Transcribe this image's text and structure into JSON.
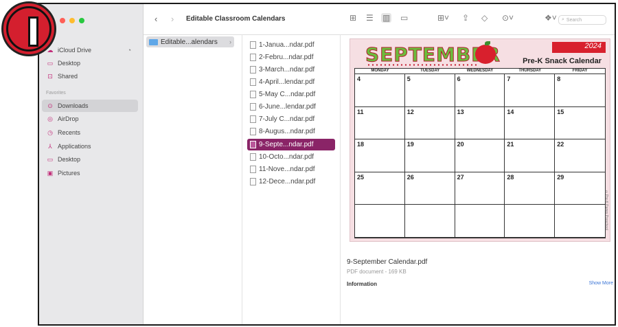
{
  "badge": {
    "glyph": "I"
  },
  "sidebar": {
    "lights": [
      "#ff5f57",
      "#febc2e",
      "#28c840"
    ],
    "icloud_drive": "iCloud Drive",
    "items_top": [
      {
        "label": "Desktop",
        "icon": "desktop-icon"
      },
      {
        "label": "Shared",
        "icon": "shared-folder-icon"
      }
    ],
    "favorites_header": "Favorites",
    "favorites": [
      {
        "label": "Downloads",
        "icon": "download-icon",
        "active": true
      },
      {
        "label": "AirDrop",
        "icon": "airdrop-icon"
      },
      {
        "label": "Recents",
        "icon": "clock-icon"
      },
      {
        "label": "Applications",
        "icon": "applications-icon"
      },
      {
        "label": "Desktop",
        "icon": "desktop-icon"
      },
      {
        "label": "Pictures",
        "icon": "pictures-icon"
      }
    ]
  },
  "toolbar": {
    "title": "Editable Classroom Calendars",
    "search_placeholder": "Search"
  },
  "columns": {
    "folder": "Editable...alendars",
    "files": [
      "1-Janua...ndar.pdf",
      "2-Febru...ndar.pdf",
      "3-March...ndar.pdf",
      "4-April...lendar.pdf",
      "5-May C...ndar.pdf",
      "6-June...lendar.pdf",
      "7-July C...ndar.pdf",
      "8-Augus...ndar.pdf",
      "9-Septe...ndar.pdf",
      "10-Octo...ndar.pdf",
      "11-Nove...ndar.pdf",
      "12-Dece...ndar.pdf"
    ],
    "selected_index": 8
  },
  "preview": {
    "calendar": {
      "month": "SEPTEMBER",
      "year": "2024",
      "subtitle": "Pre-K Snack Calendar",
      "days": [
        "MONDAY",
        "TUESDAY",
        "WEDNESDAY",
        "THURSDAY",
        "FRIDAY"
      ],
      "weeks": [
        [
          "4",
          "5",
          "6",
          "7",
          "8"
        ],
        [
          "11",
          "12",
          "13",
          "14",
          "15"
        ],
        [
          "18",
          "19",
          "20",
          "21",
          "22"
        ],
        [
          "25",
          "26",
          "27",
          "28",
          "29"
        ],
        [
          "",
          "",
          "",
          "",
          ""
        ]
      ],
      "credit": "©Pre-K Pages Preschool"
    },
    "filename": "9-September Calendar.pdf",
    "kind": "PDF document - 169 KB",
    "info_label": "Information",
    "show_more": "Show More"
  }
}
